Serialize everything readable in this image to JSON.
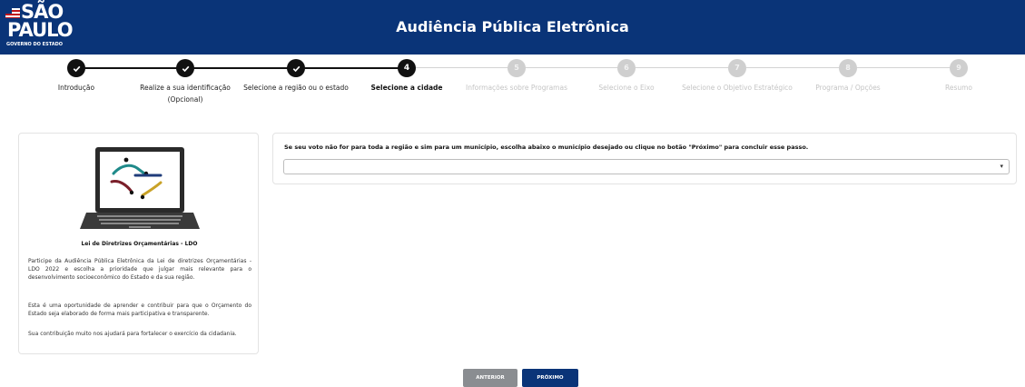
{
  "header": {
    "logo_line1": "SÃO",
    "logo_line2": "PAULO",
    "logo_line3": "GOVERNO DO ESTADO",
    "title": "Audiência Pública Eletrônica"
  },
  "colors": {
    "header_bg": "#0a3478",
    "step_done": "#111111",
    "step_pending": "#cfcfcf",
    "button_prev": "#8a8d91",
    "button_next": "#0a3478"
  },
  "steps": [
    {
      "number": "",
      "label": "Introdução",
      "label2": "",
      "status": "done"
    },
    {
      "number": "",
      "label": "Realize a sua identificação",
      "label2": "(Opcional)",
      "status": "done"
    },
    {
      "number": "",
      "label": "Selecione a região ou o estado",
      "label2": "",
      "status": "done"
    },
    {
      "number": "4",
      "label": "Selecione a cidade",
      "label2": "",
      "status": "current"
    },
    {
      "number": "5",
      "label": "Informações sobre Programas",
      "label2": "",
      "status": "pending"
    },
    {
      "number": "6",
      "label": "Selecione o Eixo",
      "label2": "",
      "status": "pending"
    },
    {
      "number": "7",
      "label": "Selecione o Objetivo Estratégico",
      "label2": "",
      "status": "pending"
    },
    {
      "number": "8",
      "label": "Programa / Opções",
      "label2": "",
      "status": "pending"
    },
    {
      "number": "9",
      "label": "Resumo",
      "label2": "",
      "status": "pending"
    }
  ],
  "sidebar": {
    "image_icon": "laptop-ldo-illustration",
    "title": "Lei de Diretrizes Orçamentárias - LDO",
    "paragraph1": "Participe da Audiência Pública Eletrônica da Lei de diretrizes Orçamentárias - LDO 2022 e escolha a prioridade que julgar mais relevante para o desenvolvimento socioeconômico do Estado e da sua região.",
    "paragraph2": "Esta é uma oportunidade de aprender e contribuir para que o Orçamento do Estado seja elaborado de forma mais participativa e transparente.",
    "paragraph3": "Sua contribuição muito nos ajudará para fortalecer o exercício da cidadania."
  },
  "main": {
    "instruction": "Se seu voto não for para toda a região e sim para um município, escolha abaixo o município desejado ou clique no botão \"Próximo\" para concluir esse passo.",
    "select_value": "",
    "select_arrow": "▾"
  },
  "buttons": {
    "prev_label": "ANTERIOR",
    "next_label": "PRÓXIMO"
  }
}
